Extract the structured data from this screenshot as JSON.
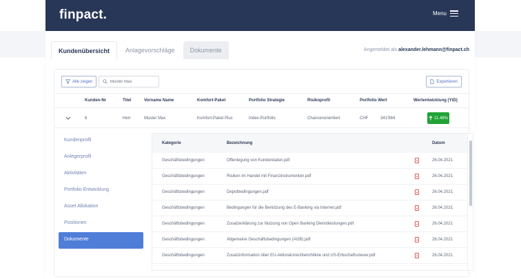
{
  "app": {
    "logo": "finpact.",
    "menu_label": "Menu"
  },
  "tabs": [
    {
      "label": "Kundenübersicht"
    },
    {
      "label": "Anlagevorschläge"
    },
    {
      "label": "Dokumente"
    }
  ],
  "user": {
    "prefix": "Angemeldet als",
    "email": "alexander.lehmann@finpact.ch"
  },
  "toolbar": {
    "show_all_label": "Alle zeigen",
    "search_value": "Muster Max",
    "export_label": "Exportieren"
  },
  "customer_table": {
    "headers": [
      "Kunden-Nr",
      "Titel",
      "Vorname Name",
      "Komfort-Paket",
      "Portfolio Strategie",
      "Risikoprofil",
      "Portfolio Wert",
      "Wertentwicklung (YtD)"
    ],
    "row": {
      "kunden_nr": "6",
      "titel": "Herr",
      "name": "Muster Max",
      "paket": "Komfort-Paket Plus",
      "strategie": "Index-Portfolio",
      "risiko": "Chancenorientiert",
      "currency": "CHF",
      "wert": "341'984",
      "performance": "11.49%"
    }
  },
  "sidebar": {
    "items": [
      {
        "label": "Kundenprofil"
      },
      {
        "label": "Anlegerprofil"
      },
      {
        "label": "Aktivitäten"
      },
      {
        "label": "Portfolio Entwicklung"
      },
      {
        "label": "Asset Allokation"
      },
      {
        "label": "Positionen"
      },
      {
        "label": "Dokumente"
      }
    ]
  },
  "documents": {
    "headers": {
      "kategorie": "Kategorie",
      "bezeichnung": "Bezeichnung",
      "datum": "Datum"
    },
    "rows": [
      {
        "kategorie": "Geschäftsbedingungen",
        "bezeichnung": "Offenlegung von Kundendaten.pdf",
        "datum": "26.04.2021"
      },
      {
        "kategorie": "Geschäftsbedingungen",
        "bezeichnung": "Risiken im Handel mit Finanzinstrumenten.pdf",
        "datum": "26.04.2021"
      },
      {
        "kategorie": "Geschäftsbedingungen",
        "bezeichnung": "Depotbedingungen.pdf",
        "datum": "26.04.2021"
      },
      {
        "kategorie": "Geschäftsbedingungen",
        "bezeichnung": "Bedingungen für die Benützung des E-Banking via Internet.pdf",
        "datum": "26.04.2021"
      },
      {
        "kategorie": "Geschäftsbedingungen",
        "bezeichnung": "Zusatzerklärung zur Nutzung von Open Banking Dienstleistungen.pdf",
        "datum": "26.04.2021"
      },
      {
        "kategorie": "Geschäftsbedingungen",
        "bezeichnung": "Allgemeine Geschäftsbedingungen (AGB).pdf",
        "datum": "26.04.2021"
      },
      {
        "kategorie": "Geschäftsbedingungen",
        "bezeichnung": "Zusatzinformation über EU-Aktionärsrechterichtlinie und US-Erbschaftssteuer.pdf",
        "datum": "26.04.2021"
      }
    ]
  },
  "colors": {
    "navbar": "#283757",
    "accent": "#4f7ed8",
    "positive": "#21a336",
    "pdf": "#e25555"
  }
}
